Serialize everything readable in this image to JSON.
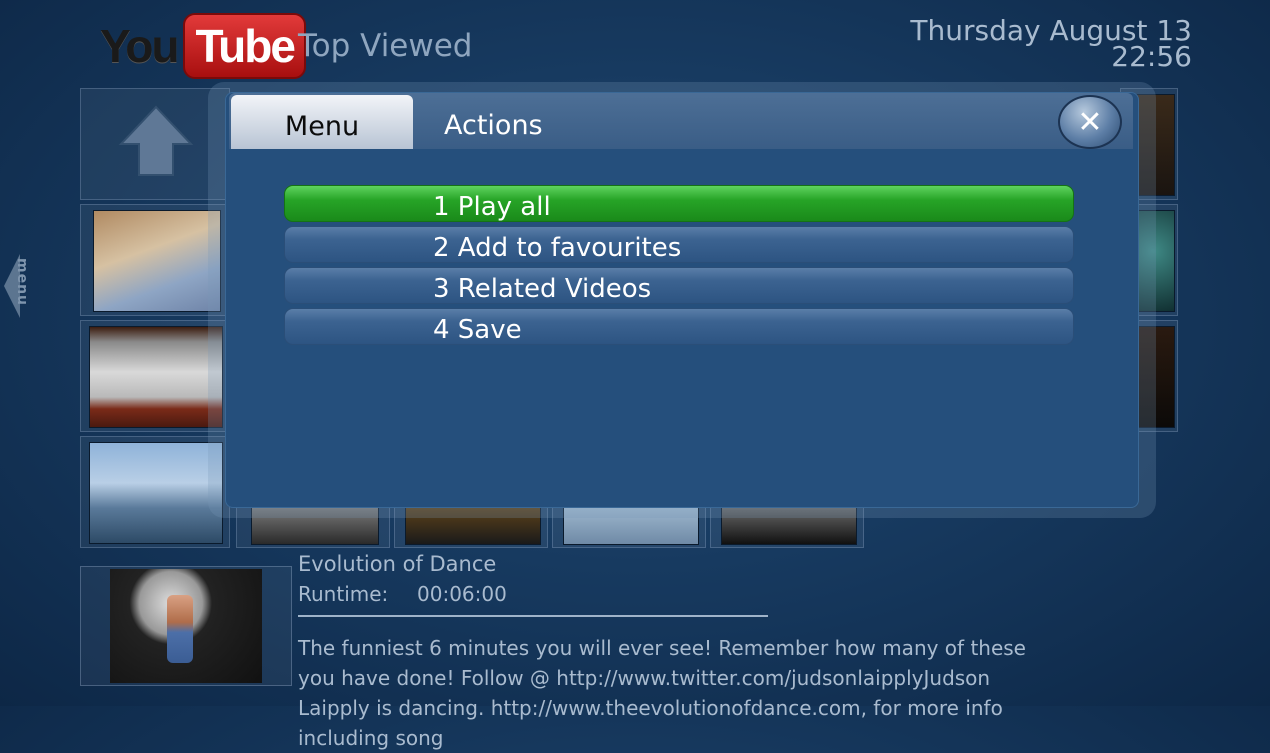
{
  "header": {
    "logo_you": "You",
    "logo_tube": "Tube",
    "title": "Top Viewed",
    "date": "Thursday August 13",
    "time": "22:56"
  },
  "side_tab": {
    "label": "menu"
  },
  "dialog": {
    "tab_menu": "Menu",
    "tab_actions": "Actions",
    "close_icon": "close-icon",
    "options": [
      {
        "label": "1 Play all",
        "selected": true
      },
      {
        "label": "2 Add to favourites",
        "selected": false
      },
      {
        "label": "3 Related Videos",
        "selected": false
      },
      {
        "label": "4 Save",
        "selected": false
      }
    ]
  },
  "details": {
    "title": "Evolution of Dance",
    "runtime_label": "Runtime:",
    "runtime_value": "00:06:00",
    "description": "The funniest 6 minutes you will ever see! Remember how many of these you have done! Follow @ http://www.twitter.com/judsonlaipplyJudson Laipply is dancing. http://www.theevolutionofdance.com, for more info including song"
  },
  "colors": {
    "accent_selected": "#27a427",
    "dialog_bg": "#254f7c"
  }
}
